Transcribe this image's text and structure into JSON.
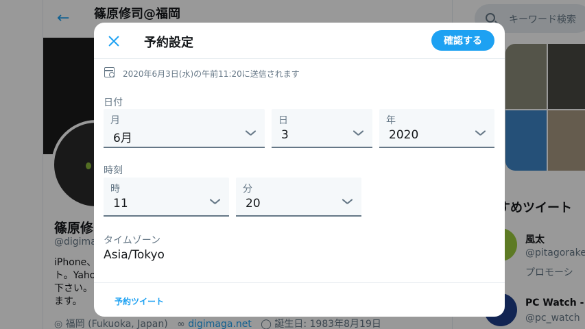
{
  "background": {
    "header_title": "篠原修司@福岡",
    "profile_name": "篠原修",
    "profile_handle": "@digima",
    "bio": "iPhone、\nト。Yaho\n下さい。\nます。",
    "location": "福岡 (Fukuoka, Japan)",
    "website": "digimaga.net",
    "birthday": "誕生日: 1983年8月19日",
    "search_placeholder": "キーワード検索",
    "recommend_title": "すすめツイート",
    "recommend": [
      {
        "name": "風太",
        "handle": "@pitagorake",
        "sub": "プロモーシ"
      },
      {
        "name": "PC Watch - S",
        "handle": "@pc_watch"
      }
    ]
  },
  "modal": {
    "title": "予約設定",
    "confirm_label": "確認する",
    "notice": "2020年6月3日(水)の午前11:20に送信されます",
    "date_section": "日付",
    "time_section": "時刻",
    "month": {
      "label": "月",
      "value": "6月"
    },
    "day": {
      "label": "日",
      "value": "3"
    },
    "year": {
      "label": "年",
      "value": "2020"
    },
    "hour": {
      "label": "時",
      "value": "11"
    },
    "minute": {
      "label": "分",
      "value": "20"
    },
    "timezone_label": "タイムゾーン",
    "timezone_value": "Asia/Tokyo",
    "footer_link": "予約ツイート"
  },
  "colors": {
    "accent": "#1da1f2",
    "overlay": "rgba(0,0,0,0.4)",
    "muted_text": "#657786"
  }
}
